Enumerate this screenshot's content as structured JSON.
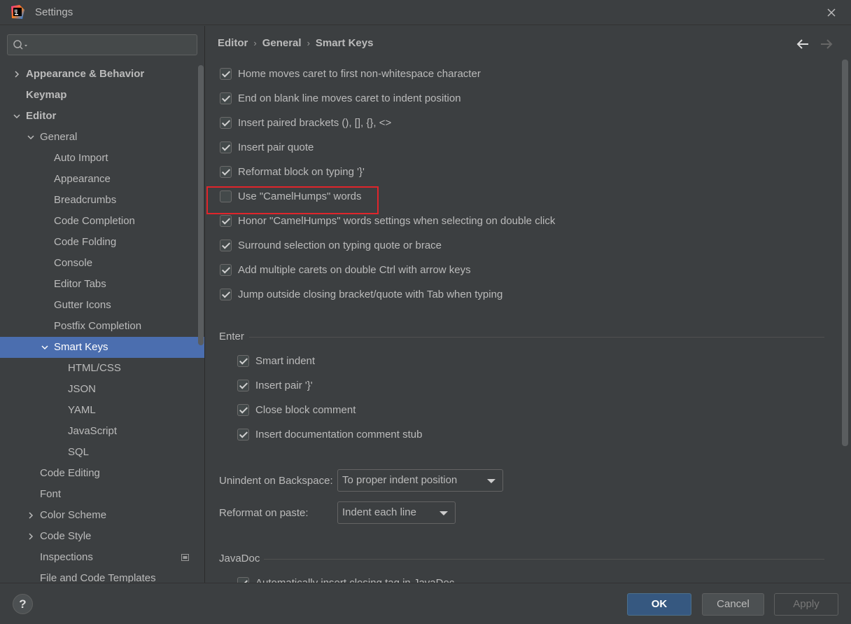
{
  "window": {
    "title": "Settings"
  },
  "sidebar": {
    "search_placeholder": "",
    "tree": [
      {
        "label": "Appearance & Behavior",
        "arrow": "right",
        "bold": true
      },
      {
        "label": "Keymap",
        "arrow": "",
        "bold": true
      },
      {
        "label": "Editor",
        "arrow": "down",
        "bold": true
      },
      {
        "label": "General",
        "arrow": "down"
      },
      {
        "label": "Auto Import"
      },
      {
        "label": "Appearance"
      },
      {
        "label": "Breadcrumbs"
      },
      {
        "label": "Code Completion"
      },
      {
        "label": "Code Folding"
      },
      {
        "label": "Console"
      },
      {
        "label": "Editor Tabs"
      },
      {
        "label": "Gutter Icons"
      },
      {
        "label": "Postfix Completion"
      },
      {
        "label": "Smart Keys",
        "arrow": "down",
        "selected": true
      },
      {
        "label": "HTML/CSS"
      },
      {
        "label": "JSON"
      },
      {
        "label": "YAML"
      },
      {
        "label": "JavaScript"
      },
      {
        "label": "SQL"
      },
      {
        "label": "Code Editing"
      },
      {
        "label": "Font"
      },
      {
        "label": "Color Scheme",
        "arrow": "right"
      },
      {
        "label": "Code Style",
        "arrow": "right"
      },
      {
        "label": "Inspections",
        "project_icon": true
      },
      {
        "label": "File and Code Templates"
      }
    ]
  },
  "breadcrumb": {
    "items": [
      "Editor",
      "General",
      "Smart Keys"
    ],
    "separator": "›"
  },
  "options": [
    {
      "label": "Home moves caret to first non-whitespace character",
      "checked": true
    },
    {
      "label": "End on blank line moves caret to indent position",
      "checked": true
    },
    {
      "label": "Insert paired brackets (), [], {}, <>",
      "checked": true
    },
    {
      "label": "Insert pair quote",
      "checked": true
    },
    {
      "label": "Reformat block on typing '}'",
      "checked": true
    },
    {
      "label": "Use \"CamelHumps\" words",
      "checked": false
    },
    {
      "label": "Honor \"CamelHumps\" words settings when selecting on double click",
      "checked": true
    },
    {
      "label": "Surround selection on typing quote or brace",
      "checked": true
    },
    {
      "label": "Add multiple carets on double Ctrl with arrow keys",
      "checked": true
    },
    {
      "label": "Jump outside closing bracket/quote with Tab when typing",
      "checked": true
    }
  ],
  "enter_section": {
    "title": "Enter",
    "options": [
      {
        "label": "Smart indent",
        "checked": true
      },
      {
        "label": "Insert pair '}'",
        "checked": true
      },
      {
        "label": "Close block comment",
        "checked": true
      },
      {
        "label": "Insert documentation comment stub",
        "checked": true
      }
    ]
  },
  "unindent": {
    "label": "Unindent on Backspace:",
    "value": "To proper indent position"
  },
  "reformat_paste": {
    "label": "Reformat on paste:",
    "value": "Indent each line"
  },
  "javadoc_section": {
    "title": "JavaDoc",
    "partial_option": "Automatically insert closing tag in JavaDoc"
  },
  "buttons": {
    "help": "?",
    "ok": "OK",
    "cancel": "Cancel",
    "apply": "Apply"
  },
  "colors": {
    "selection": "#4b6eaf",
    "highlight_box": "#e0252b",
    "ok_button": "#365880"
  }
}
